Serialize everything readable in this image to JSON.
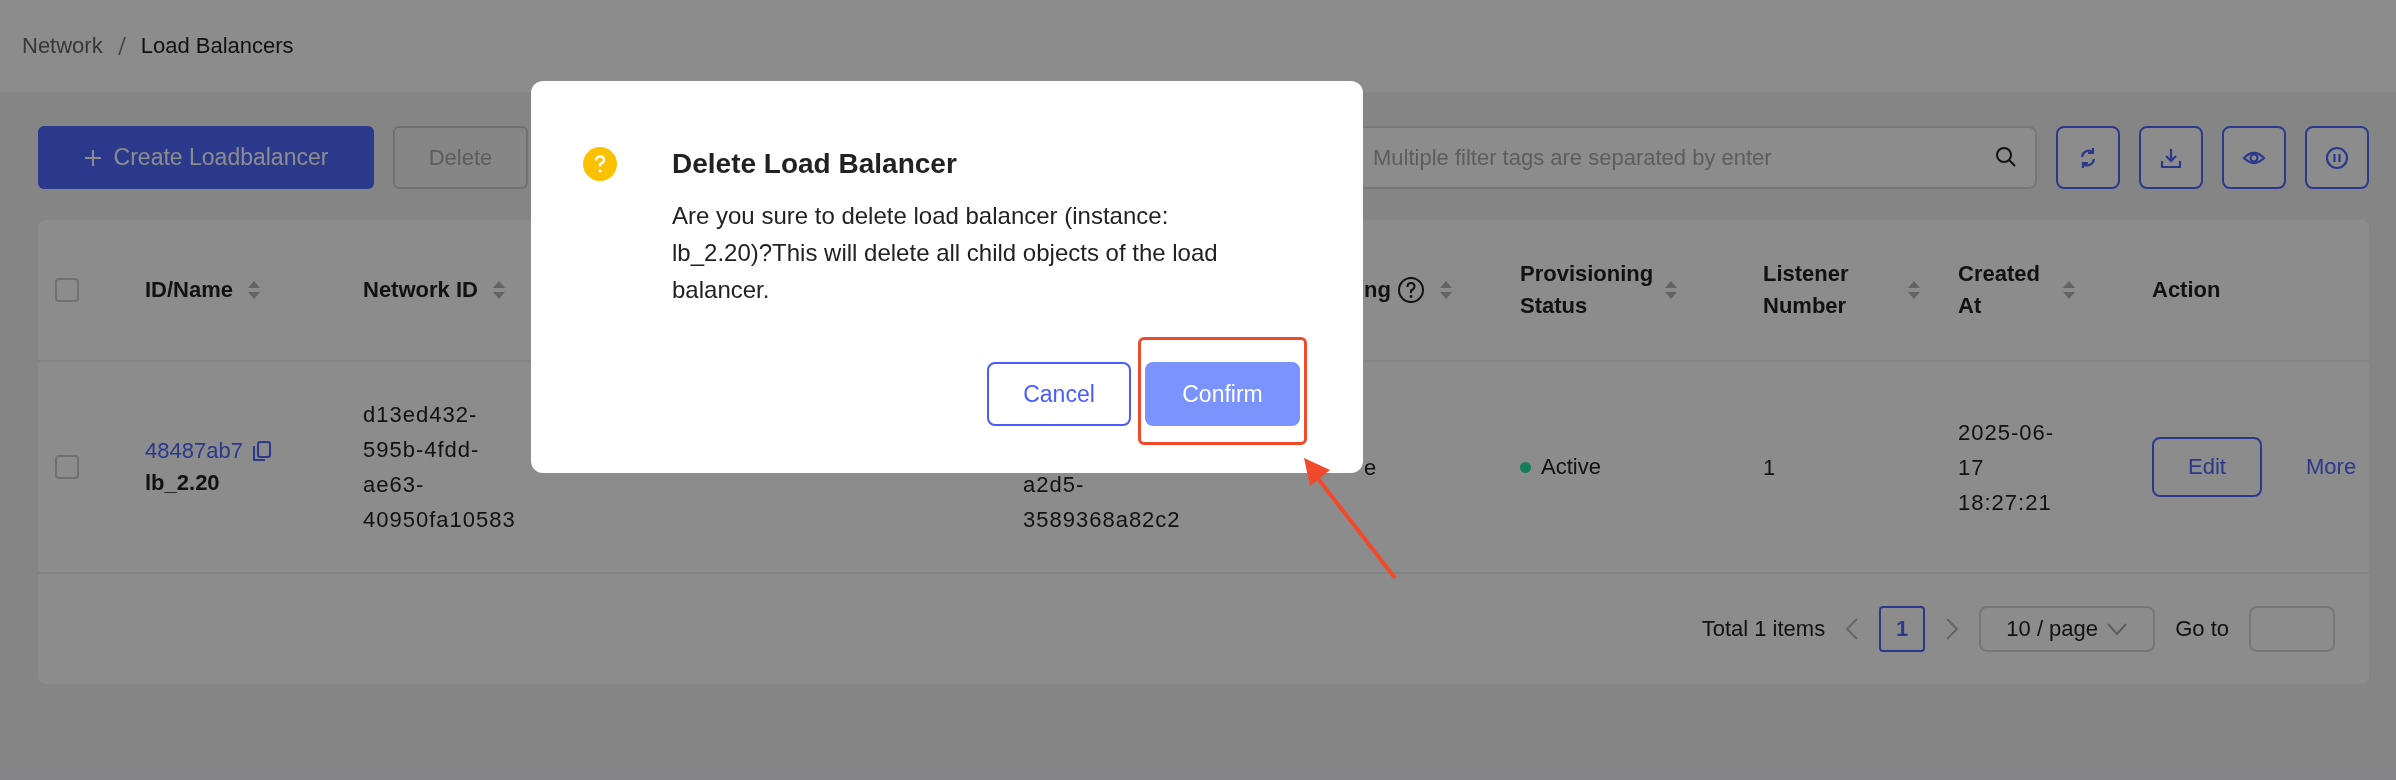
{
  "breadcrumb": [
    {
      "label": "Network",
      "current": false
    },
    {
      "label": "Load Balancers",
      "current": true
    }
  ],
  "toolbar": {
    "create_button": {
      "label": "Create Loadbalancer"
    },
    "delete_button": {
      "label": "Delete",
      "disabled": true
    },
    "search": {
      "placeholder": "Multiple filter tags are separated by enter"
    },
    "icon_buttons": [
      {
        "kind": "refresh"
      },
      {
        "kind": "download"
      },
      {
        "kind": "view"
      },
      {
        "kind": "pause"
      }
    ]
  },
  "table": {
    "select_all": {
      "checked": false
    },
    "header": {
      "id_name": {
        "label": "ID/Name",
        "sortable": true
      },
      "network_id": {
        "label": "Network ID",
        "sortable": true
      },
      "column_6": {
        "label": "ng",
        "help": true,
        "sortable": true
      },
      "provisioning_status": {
        "label": "Provisioning Status",
        "sortable": true
      },
      "listener_number": {
        "label": "Listener Number",
        "sortable": true
      },
      "created_at": {
        "label": "Created At",
        "sortable": true
      },
      "action": {
        "label": "Action",
        "sortable": false
      }
    },
    "rows": [
      {
        "selected": false,
        "id": "48487ab7",
        "name": "lb_2.20",
        "network_id": "d13ed432-\n595b-4fdd-\nae63-\n40950fa10583",
        "column_5": "a2d5-\n3589368a82c2",
        "column_6": "e",
        "provisioning_status": {
          "label": "Active",
          "color": "#10805a"
        },
        "listener_number": "1",
        "created_at": "2025-06-\n17\n18:27:21",
        "actions": [
          {
            "label": "Edit",
            "kind": "button"
          },
          {
            "label": "More",
            "kind": "link"
          }
        ]
      }
    ]
  },
  "pagination": {
    "total": "Total 1 items",
    "prev_disabled": true,
    "pages": [
      {
        "label": "1",
        "selected": true
      }
    ],
    "next_disabled": true,
    "page_size": "10 / page",
    "goto_label": "Go to"
  },
  "dialog": {
    "title": "Delete Load Balancer",
    "message": "Are you sure to delete load balancer (instance: lb_2.20)?This will delete all child objects of the load balancer.",
    "buttons": [
      {
        "label": "Cancel",
        "kind": "secondary",
        "highlighted": false
      },
      {
        "label": "Confirm",
        "kind": "primary",
        "highlighted": true
      }
    ]
  }
}
